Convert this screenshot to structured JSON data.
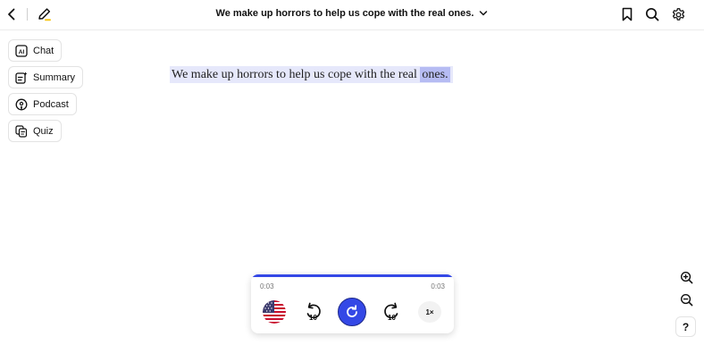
{
  "header": {
    "title": "We make up horrors to help us cope with the real ones."
  },
  "sidebar": {
    "items": [
      {
        "label": "Chat",
        "icon": "ai-icon"
      },
      {
        "label": "Summary",
        "icon": "summary-icon"
      },
      {
        "label": "Podcast",
        "icon": "podcast-icon"
      },
      {
        "label": "Quiz",
        "icon": "quiz-icon"
      }
    ]
  },
  "reader": {
    "text_before": "We make up horrors to help us cope with the real ",
    "highlighted_word": "ones.",
    "highlight_color": "#e6e8fb",
    "active_word_color": "#b6bcf3"
  },
  "player": {
    "current_time": "0:03",
    "total_time": "0:03",
    "progress": 1.0,
    "rewind_seconds": "10",
    "forward_seconds": "10",
    "speed": "1×",
    "voice_flag": "us-flag-icon",
    "accent_color": "#3448e6"
  },
  "help_label": "?"
}
